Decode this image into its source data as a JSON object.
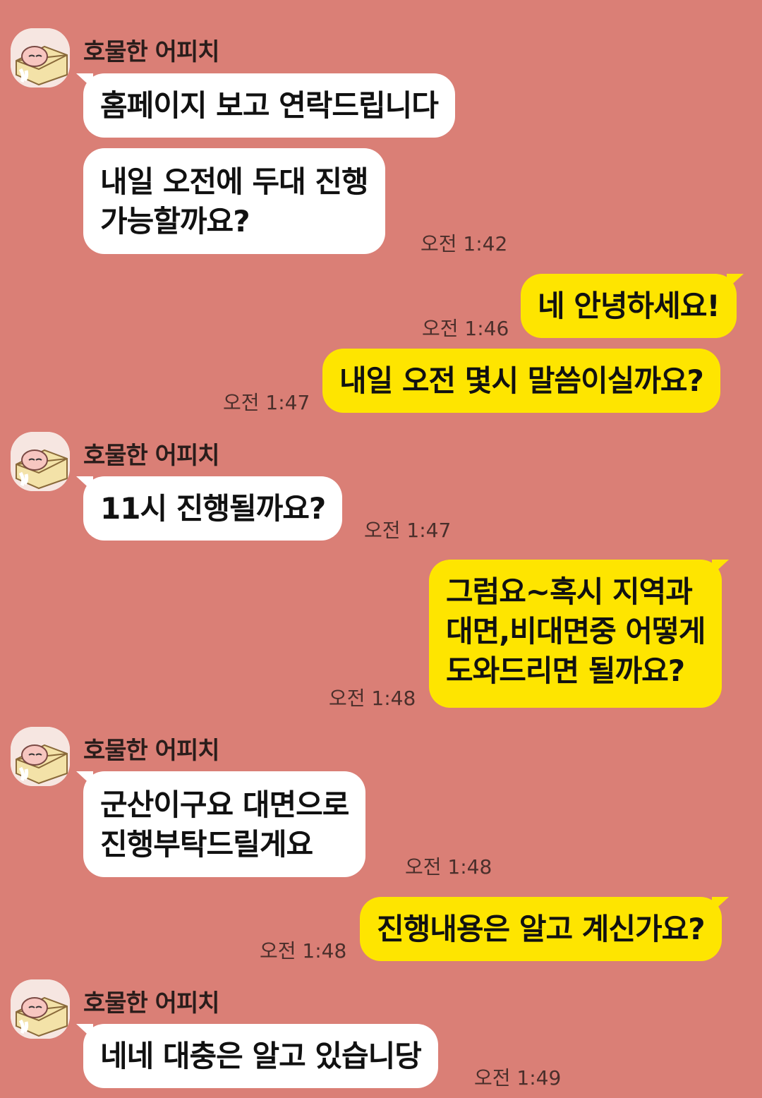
{
  "colors": {
    "background": "#DA7F76",
    "incoming_bubble": "#FFFFFF",
    "outgoing_bubble": "#FEE500"
  },
  "messages": [
    {
      "sender": "호물한 어피치",
      "lines": [
        "홈페이지 보고 연락드립니다"
      ]
    },
    {
      "lines": [
        "내일 오전에 두대 진행",
        "가능할까요?"
      ],
      "time": "오전 1:42"
    },
    {
      "lines": [
        "네 안녕하세요!"
      ],
      "time": "오전 1:46"
    },
    {
      "lines": [
        "내일 오전 몇시 말씀이실까요?"
      ],
      "time": "오전 1:47"
    },
    {
      "sender": "호물한 어피치",
      "lines": [
        "11시 진행될까요?"
      ],
      "time": "오전 1:47"
    },
    {
      "lines": [
        "그럼요~혹시 지역과",
        "대면,비대면중 어떻게",
        "도와드리면 될까요?"
      ],
      "time": "오전 1:48"
    },
    {
      "sender": "호물한 어피치",
      "lines": [
        "군산이구요 대면으로",
        "진행부탁드릴게요"
      ],
      "time": "오전 1:48"
    },
    {
      "lines": [
        "진행내용은 알고 계신가요?"
      ],
      "time": "오전 1:48"
    },
    {
      "sender": "호물한 어피치",
      "lines": [
        "네네 대충은 알고 있습니당"
      ],
      "time": "오전 1:49"
    }
  ],
  "avatar_icon": "apeach-character-icon"
}
